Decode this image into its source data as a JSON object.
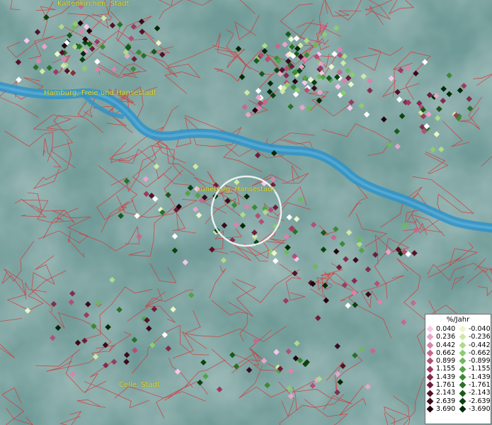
{
  "labels": {
    "kaltenkirchen": "Kaltenkirchen, Stadt",
    "hamburg": "Hamburg, Freie und Hansestadt",
    "lueneburg": "Lüneburg, Hansestadt",
    "celle": "Celle, Stadt"
  },
  "legend": {
    "title": "%/Jahr",
    "positive": [
      {
        "value": "0.040",
        "color": "#f7c8ea"
      },
      {
        "value": "0.236",
        "color": "#e7a5c9"
      },
      {
        "value": "0.442",
        "color": "#d884ad"
      },
      {
        "value": "0.662",
        "color": "#c66890"
      },
      {
        "value": "0.899",
        "color": "#b25077"
      },
      {
        "value": "1.155",
        "color": "#9b3b5f"
      },
      {
        "value": "1.439",
        "color": "#852b4b"
      },
      {
        "value": "1.761",
        "color": "#6e1e3a"
      },
      {
        "value": "2.143",
        "color": "#54122a"
      },
      {
        "value": "2.639",
        "color": "#3a0a1b"
      },
      {
        "value": "3.690",
        "color": "#22030c"
      }
    ],
    "negative": [
      {
        "value": "-0.040",
        "color": "#ecf6c6"
      },
      {
        "value": "-0.236",
        "color": "#cfe8a5"
      },
      {
        "value": "-0.442",
        "color": "#addb8a"
      },
      {
        "value": "-0.662",
        "color": "#8ecb72"
      },
      {
        "value": "-0.899",
        "color": "#6fb85b"
      },
      {
        "value": "-1.155",
        "color": "#53a246"
      },
      {
        "value": "-1.439",
        "color": "#3b8a34"
      },
      {
        "value": "-1.761",
        "color": "#287126"
      },
      {
        "value": "-2.143",
        "color": "#175a19"
      },
      {
        "value": "-2.639",
        "color": "#0b420e"
      },
      {
        "value": "-3.690",
        "color": "#032905"
      }
    ]
  },
  "colors": {
    "background": "#6f9a97",
    "river": "#2f93c9",
    "borders": "#d23a3a",
    "label": "#e8e23a",
    "highlight": "#ffffff"
  }
}
